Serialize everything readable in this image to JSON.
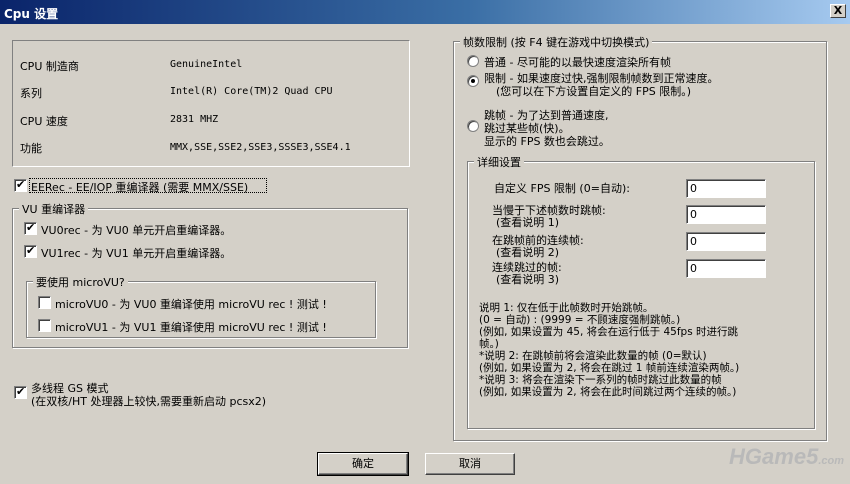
{
  "window": {
    "title": "Cpu 设置",
    "close": "X"
  },
  "cpu_info": {
    "rows": [
      {
        "label": "CPU 制造商",
        "value": "GenuineIntel"
      },
      {
        "label": "系列",
        "value": "Intel(R) Core(TM)2 Quad CPU"
      },
      {
        "label": "CPU 速度",
        "value": "2831 MHZ"
      },
      {
        "label": "功能",
        "value": "MMX,SSE,SSE2,SSE3,SSSE3,SSE4.1"
      }
    ]
  },
  "eerec": {
    "label": "EERec -  EE/IOP 重编译器 (需要 MMX/SSE)",
    "checked": true
  },
  "vu": {
    "legend": "VU  重编译器",
    "vu0": {
      "label": "VU0rec - 为 VU0 单元开启重编译器。",
      "checked": true
    },
    "vu1": {
      "label": "VU1rec - 为 VU1 单元开启重编译器。",
      "checked": true
    },
    "microvu": {
      "legend": "要使用 microVU?",
      "mvu0": {
        "label": "microVU0 - 为 VU0 重编译使用 microVU rec ! 测试 !",
        "checked": false
      },
      "mvu1": {
        "label": "microVU1 - 为 VU1 重编译使用 microVU rec ! 测试 !",
        "checked": false
      }
    }
  },
  "gs_thread": {
    "line1": "多线程 GS 模式",
    "line2": "(在双核/HT 处理器上较快,需要重新启动 pcsx2)",
    "checked": true
  },
  "frame_limit": {
    "legend": "帧数限制 (按 F4 键在游戏中切换模式)",
    "normal": {
      "label": "普通 - 尽可能的以最快速度渲染所有帧",
      "selected": false
    },
    "limit": {
      "line1": "限制 - 如果速度过快,强制限制帧数到正常速度。",
      "line2": "(您可以在下方设置自定义的 FPS 限制。)",
      "selected": true
    },
    "skip": {
      "line1": "跳帧 - 为了达到普通速度,",
      "line2": "跳过某些帧(快)。",
      "line3": "显示的 FPS 数也会跳过。",
      "selected": false
    }
  },
  "detail": {
    "legend": "详细设置",
    "fields": [
      {
        "label1": "自定义 FPS 限制 (0=自动):",
        "label2": "",
        "value": "0"
      },
      {
        "label1": "当慢于下述帧数时跳帧:",
        "label2": "(查看说明 1)",
        "value": "0"
      },
      {
        "label1": "在跳帧前的连续帧:",
        "label2": "(查看说明 2)",
        "value": "0"
      },
      {
        "label1": "连续跳过的帧:",
        "label2": "(查看说明 3)",
        "value": "0"
      }
    ],
    "notes": [
      "说明 1: 仅在低于此帧数时开始跳帧。",
      "  (0 = 自动) : (9999 = 不顾速度强制跳帧。)",
      "  (例如, 如果设置为 45, 将会在运行低于 45fps 时进行跳",
      "帧。)",
      "*说明 2: 在跳帧前将会渲染此数量的帧 (0=默认)",
      "  (例如, 如果设置为 2, 将会在跳过 1 帧前连续渲染两帧。)",
      "*说明 3: 将会在渲染下一系列的帧时跳过此数量的帧",
      "  (例如, 如果设置为 2, 将会在此时间跳过两个连续的帧。)"
    ]
  },
  "buttons": {
    "ok": "确定",
    "cancel": "取消"
  },
  "watermark": {
    "main": "HGame5",
    "suffix": ".com"
  }
}
